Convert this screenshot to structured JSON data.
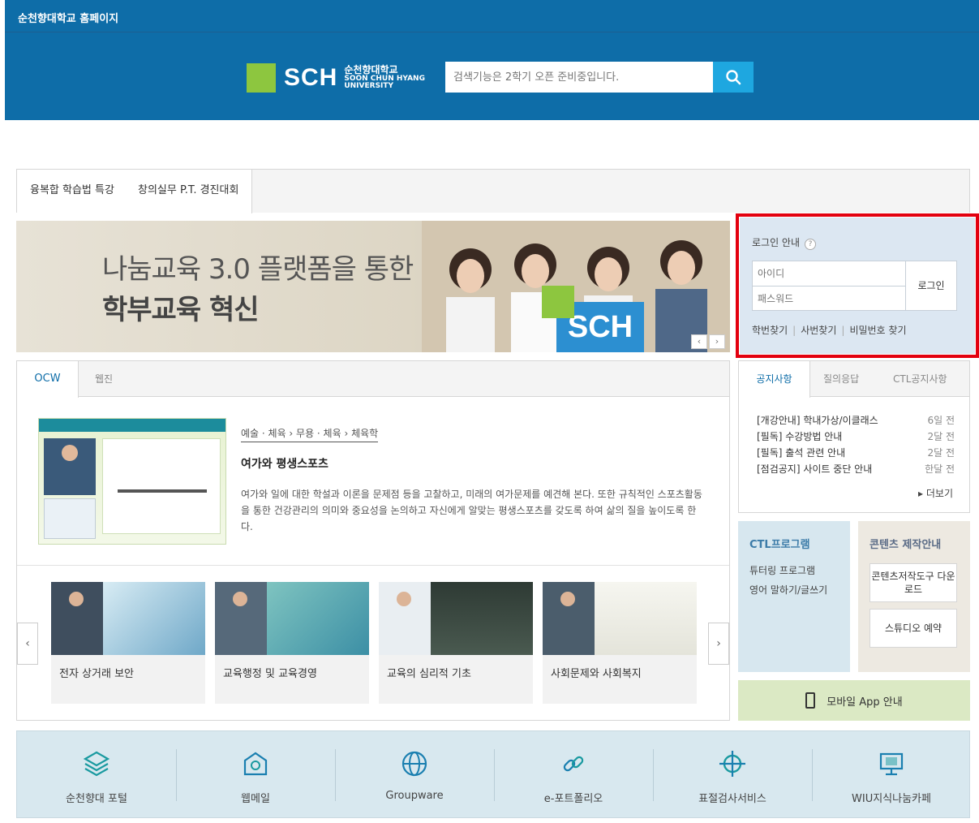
{
  "site_title": "순천향대학교 홈페이지",
  "logo": {
    "mark": "SCH",
    "name_ko": "순천향대학교",
    "name_en_1": "SOON CHUN HYANG",
    "name_en_2": "UNIVERSITY"
  },
  "search": {
    "placeholder": "검색기능은 2학기 오픈 준비중입니다.",
    "icon": "search-icon"
  },
  "top_tabs": [
    "융복합 학습법 특강",
    "창의실무 P.T. 경진대회"
  ],
  "banner": {
    "line1": "나눔교육 3.0 플랫폼을 통한",
    "line2": "학부교육 혁신",
    "card": "SCH",
    "prev": "‹",
    "next": "›"
  },
  "login": {
    "title": "로그인 안내",
    "help": "?",
    "id_placeholder": "아이디",
    "pw_placeholder": "패스워드",
    "button": "로그인",
    "links": [
      "학번찾기",
      "사번찾기",
      "비밀번호 찾기"
    ]
  },
  "ocw": {
    "tabs": [
      "OCW",
      "웹진"
    ],
    "featured": {
      "category": "예술 · 체육 › 무용 · 체육 › 체육학",
      "title": "여가와 평생스포츠",
      "description": "여가와 일에 대한 학설과 이론을 문제점 등을 고찰하고, 미래의 여가문제를 예견해 본다. 또한 규칙적인 스포츠활동을 통한 건강관리의 의미와 중요성을 논의하고 자신에게 알맞는 평생스포츠를 갖도록 하여 삶의 질을 높이도록 한다."
    },
    "prev": "‹",
    "next": "›",
    "courses": [
      "전자 상거래 보안",
      "교육행정 및 교육경영",
      "교육의 심리적 기초",
      "사회문제와 사회복지"
    ]
  },
  "notice": {
    "tabs": [
      "공지사항",
      "질의응답",
      "CTL공지사항"
    ],
    "items": [
      {
        "title": "[개강안내] 학내가상/이클래스",
        "date": "6일 전"
      },
      {
        "title": "[필독] 수강방법 안내",
        "date": "2달 전"
      },
      {
        "title": "[필독] 출석 관련 안내",
        "date": "2달 전"
      },
      {
        "title": "[점검공지] 사이트 중단 안내",
        "date": "한달 전"
      }
    ],
    "more": "▸ 더보기"
  },
  "ctl": {
    "title": "CTL프로그램",
    "items": [
      "튜터링 프로그램",
      "영어 말하기/글쓰기"
    ]
  },
  "contents": {
    "title": "콘텐츠 제작안내",
    "buttons": [
      "콘텐츠저작도구 다운로드",
      "스튜디오 예약"
    ]
  },
  "mobile": {
    "label": "모바일 App 안내"
  },
  "quick_links": [
    {
      "label": "순천향대 포털",
      "icon": "layers-icon"
    },
    {
      "label": "웹메일",
      "icon": "mail-icon"
    },
    {
      "label": "Groupware",
      "icon": "globe-icon"
    },
    {
      "label": "e-포트폴리오",
      "icon": "link-icon"
    },
    {
      "label": "표절검사서비스",
      "icon": "crosshair-icon"
    },
    {
      "label": "WIU지식나눔카페",
      "icon": "monitor-icon"
    }
  ],
  "colors": {
    "primary": "#0e6da8",
    "accent": "#1ea7e0",
    "green": "#8dc63f",
    "highlight": "#e3000f"
  }
}
